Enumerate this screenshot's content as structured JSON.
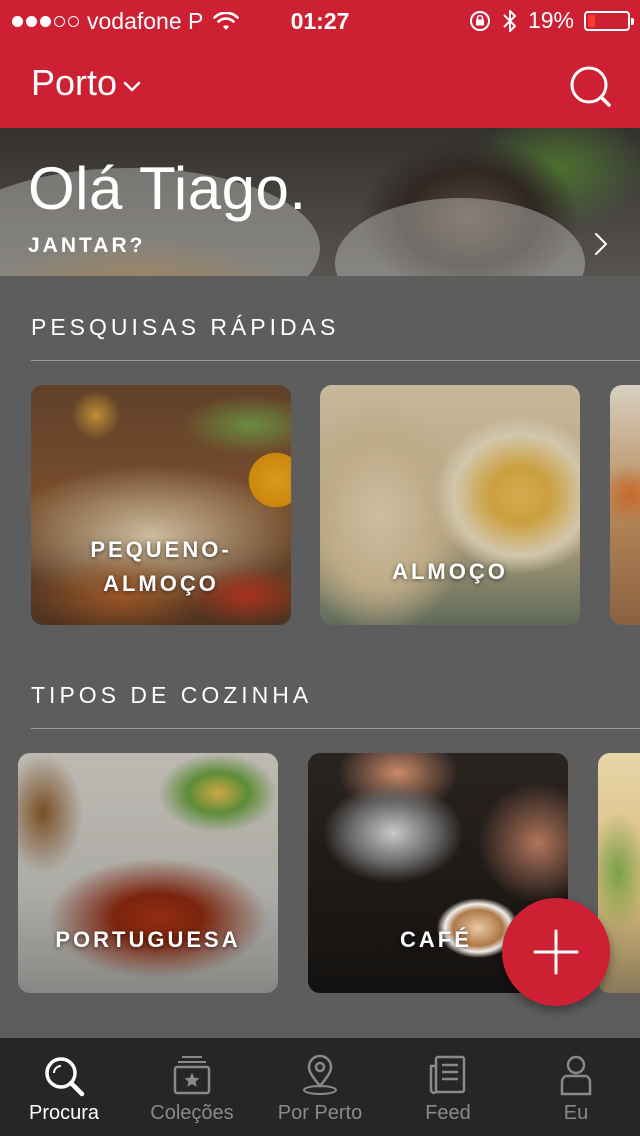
{
  "status_bar": {
    "carrier": "vodafone P",
    "time": "01:27",
    "battery": "19%",
    "battery_level": 0.19,
    "signal_bars_filled": 3,
    "signal_bars_total": 5
  },
  "nav": {
    "city": "Porto"
  },
  "hero": {
    "greeting": "Olá Tiago.",
    "cta": "JANTAR?"
  },
  "quick_search": {
    "title": "PESQUISAS RÁPIDAS",
    "cards": [
      {
        "label_line1": "PEQUENO-",
        "label_line2": "ALMOÇO"
      },
      {
        "label": "ALMOÇO"
      }
    ]
  },
  "cuisines": {
    "title": "TIPOS DE COZINHA",
    "cards": [
      {
        "label": "PORTUGUESA"
      },
      {
        "label": "CAFÉ"
      }
    ]
  },
  "tabs": [
    {
      "label": "Procura",
      "icon": "search-icon",
      "active": true
    },
    {
      "label": "Coleções",
      "icon": "collections-icon",
      "active": false
    },
    {
      "label": "Por Perto",
      "icon": "location-pin-icon",
      "active": false
    },
    {
      "label": "Feed",
      "icon": "feed-icon",
      "active": false
    },
    {
      "label": "Eu",
      "icon": "user-icon",
      "active": false
    }
  ],
  "colors": {
    "brand": "#cd2033",
    "background": "#5d5d5d",
    "tab_bar": "#262626"
  }
}
